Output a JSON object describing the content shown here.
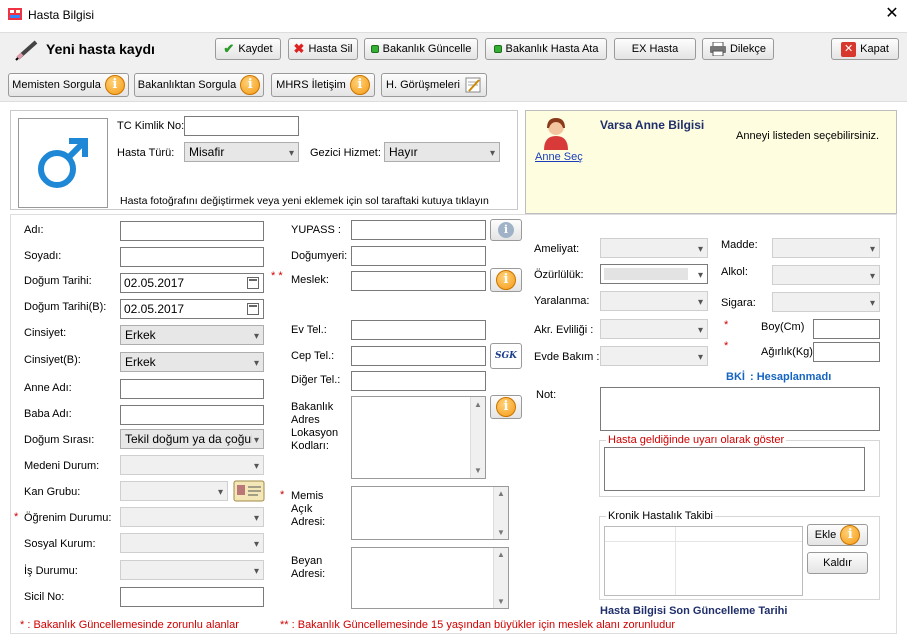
{
  "window": {
    "title": "Hasta Bilgisi",
    "close": "✕"
  },
  "toolbar1": {
    "heading": "Yeni hasta kaydı",
    "kaydet": "Kaydet",
    "hasta_sil": "Hasta Sil",
    "bakanlik_guncelle": "Bakanlık Güncelle",
    "bakanlik_hasta_ata": "Bakanlık Hasta Ata",
    "ex_hasta": "EX Hasta",
    "dilekce": "Dilekçe",
    "kapat": "Kapat"
  },
  "toolbar2": {
    "memisten": "Memisten Sorgula",
    "bakanliktan": "Bakanlıktan Sorgula",
    "mhrs": "MHRS İletişim",
    "gorusmeler": "H. Görüşmeleri"
  },
  "photo": {
    "tc_label": "TC Kimlik No:",
    "tc_value": "",
    "hasta_turu_label": "Hasta Türü:",
    "hasta_turu_value": "Misafir",
    "gezici_label": "Gezici Hizmet:",
    "gezici_value": "Hayır",
    "hint": "Hasta fotoğrafını değiştirmek veya yeni eklemek için sol taraftaki kutuya tıklayın"
  },
  "mother": {
    "title": "Varsa Anne Bilgisi",
    "link": "Anne Seç",
    "note": "Anneyi listeden seçebilirsiniz."
  },
  "col1": {
    "adi": "Adı:",
    "soyadi": "Soyadı:",
    "dogum_tarihi": "Doğum Tarihi:",
    "dogum_tarihi_val": "02.05.2017",
    "dogum_tarihi_b": "Doğum Tarihi(B):",
    "dogum_tarihi_b_val": "02.05.2017",
    "cinsiyet": "Cinsiyet:",
    "cinsiyet_val": "Erkek",
    "cinsiyet_b": "Cinsiyet(B):",
    "cinsiyet_b_val": "Erkek",
    "anne_adi": "Anne Adı:",
    "baba_adi": "Baba Adı:",
    "dogum_sirasi": "Doğum Sırası:",
    "dogum_sirasi_val": "Tekil doğum ya da çoğul d",
    "medeni": "Medeni Durum:",
    "kan": "Kan Grubu:",
    "ogrenim": "Öğrenim Durumu:",
    "sosyal": "Sosyal Kurum:",
    "is": "İş Durumu:",
    "sicil": "Sicil No:"
  },
  "col2": {
    "yupass": "YUPASS :",
    "dogumyeri": "Doğumyeri:",
    "meslek": "Meslek:",
    "ev_tel": "Ev Tel.:",
    "cep_tel": "Cep Tel.:",
    "diger_tel": "Diğer Tel.:",
    "adres": "Bakanlık Adres Lokasyon Kodları:",
    "memis": "Memis Açık Adresi:",
    "beyan": "Beyan Adresi:",
    "sgk": "SGK"
  },
  "col3": {
    "ameliyat": "Ameliyat:",
    "ozurluluk": "Özürlülük:",
    "yaralanma": "Yaralanma:",
    "akr": "Akr. Evliliği :",
    "evde": "Evde Bakım :",
    "madde": "Madde:",
    "alkol": "Alkol:",
    "sigara": "Sigara:",
    "boy": "Boy(Cm)",
    "agirlik": "Ağırlık(Kg)",
    "bki_label": "BKİ",
    "bki_value": ": Hesaplanmadı",
    "not": "Not:",
    "uyari_legend": "Hasta geldiğinde uyarı olarak göster",
    "kronik_legend": "Kronik Hastalık Takibi",
    "ekle": "Ekle",
    "kaldir": "Kaldır",
    "son_guncelleme": "Hasta Bilgisi Son Güncelleme Tarihi"
  },
  "footer": {
    "note1": "* : Bakanlık Güncellemesinde zorunlu alanlar",
    "note2": "** : Bakanlık Güncellemesinde 15 yaşından büyükler için meslek alanı zorunludur"
  },
  "colors": {
    "accent_blue": "#1e88d6",
    "required_red": "#d00000",
    "bki_blue": "#1565c0",
    "mother_bg": "#fffde0"
  },
  "icons": {
    "info": "i",
    "arrow": "▾"
  }
}
